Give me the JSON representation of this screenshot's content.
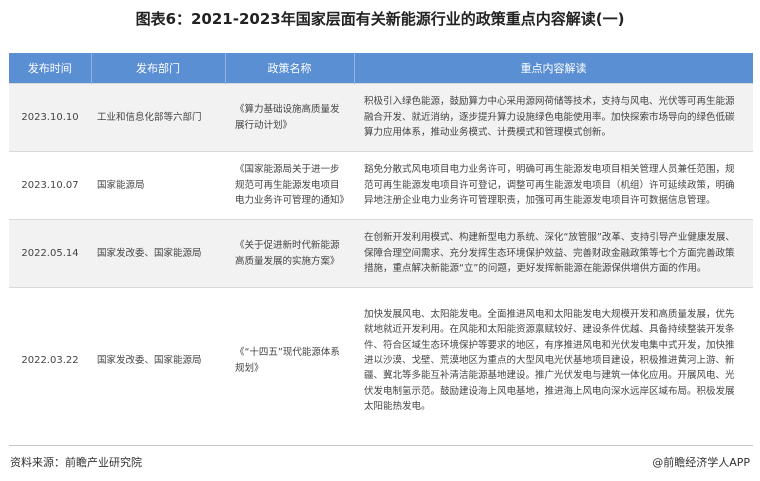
{
  "title": "图表6：2021-2023年国家层面有关新能源行业的政策重点内容解读(一)",
  "table": {
    "headers": [
      "发布时间",
      "发布部门",
      "政策名称",
      "重点内容解读"
    ],
    "rows": [
      {
        "date": "2023.10.10",
        "dept": "工业和信息化部等六部门",
        "policy": "《算力基础设施高质量发展行动计划》",
        "content": "积极引入绿色能源，鼓励算力中心采用源网荷储等技术，支持与风电、光伏等可再生能源融合开发、就近消纳，逐步提升算力设施绿色电能使用率。加快探索市场导向的绿色低碳算力应用体系，推动业务模式、计费模式和管理模式创新。"
      },
      {
        "date": "2023.10.07",
        "dept": "国家能源局",
        "policy": "《国家能源局关于进一步规范可再生能源发电项目电力业务许可管理的通知》",
        "content": "豁免分散式风电项目电力业务许可，明确可再生能源发电项目相关管理人员兼任范围，规范可再生能源发电项目许可登记，调整可再生能源发电项目（机组）许可延续政策，明确异地注册企业电力业务许可管理职责，加强可再生能源发电项目许可数据信息管理。"
      },
      {
        "date": "2022.05.14",
        "dept": "国家发改委、国家能源局",
        "policy": "《关于促进新时代新能源高质量发展的实施方案》",
        "content": "在创新开发利用模式、构建新型电力系统、深化“放管服”改革、支持引导产业健康发展、保障合理空间需求、充分发挥生态环境保护效益、完善财政金融政策等七个方面完善政策措施，重点解决新能源“立”的问题，更好发挥新能源在能源保供增供方面的作用。"
      },
      {
        "date": "2022.03.22",
        "dept": "国家发改委、国家能源局",
        "policy": "《“十四五”现代能源体系规划》",
        "content": "加快发展风电、太阳能发电。全面推进风电和太阳能发电大规模开发和高质量发展，优先就地就近开发利用。在风能和太阳能资源禀赋较好、建设条件优越、具备持续整装开发条件、符合区域生态环境保护等要求的地区，有序推进风电和光伏发电集中式开发，加快推进以沙漠、戈壁、荒漠地区为重点的大型风电光伏基地项目建设，积极推进黄河上游、新疆、冀北等多能互补清洁能源基地建设。推广光伏发电与建筑一体化应用。开展风电、光伏发电制氢示范。鼓励建设海上风电基地，推进海上风电向深水远岸区域布局。积极发展太阳能热发电。"
      }
    ]
  },
  "footer": {
    "source": "资料来源：前瞻产业研究院",
    "credit": "@前瞻经济学人APP"
  },
  "watermark": "前瞻产业研究院",
  "colors": {
    "header_bg": "#5a8fd4",
    "row_alt": "#f2f2f2"
  }
}
